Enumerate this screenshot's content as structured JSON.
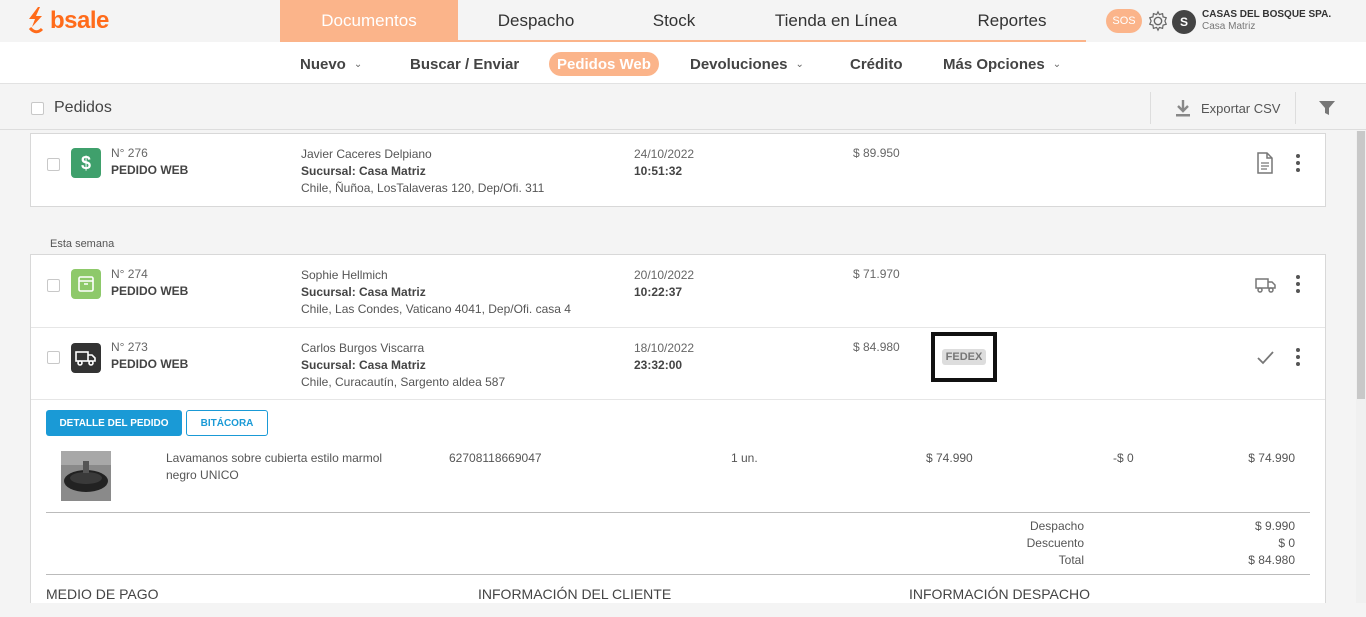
{
  "brand": {
    "name": "bsale",
    "accent": "#ff6b1a",
    "nav_active": "#fbb48a",
    "primary_button": "#1a9ad6"
  },
  "main_nav": [
    {
      "label": "Documentos",
      "active": true
    },
    {
      "label": "Despacho",
      "active": false
    },
    {
      "label": "Stock",
      "active": false
    },
    {
      "label": "Tienda en Línea",
      "active": false
    },
    {
      "label": "Reportes",
      "active": false
    }
  ],
  "header": {
    "sos": "SOS",
    "avatar_initial": "S",
    "company_name": "CASAS DEL BOSQUE SPA.",
    "branch": "Casa Matriz"
  },
  "sub_nav": [
    {
      "label": "Nuevo",
      "dropdown": true,
      "active": false
    },
    {
      "label": "Buscar / Enviar",
      "dropdown": false,
      "active": false
    },
    {
      "label": "Pedidos Web",
      "dropdown": false,
      "active": true
    },
    {
      "label": "Devoluciones",
      "dropdown": true,
      "active": false
    },
    {
      "label": "Crédito",
      "dropdown": false,
      "active": false
    },
    {
      "label": "Más Opciones",
      "dropdown": true,
      "active": false
    }
  ],
  "toolbar": {
    "title": "Pedidos",
    "export_label": "Exportar CSV"
  },
  "orders_top": [
    {
      "number": "N° 276",
      "type": "PEDIDO WEB",
      "client": "Javier Caceres Delpiano",
      "branch": "Sucursal: Casa Matriz",
      "address": "Chile, Ñuñoa, LosTalaveras 120, Dep/Ofi. 311",
      "date": "24/10/2022",
      "time": "10:51:32",
      "amount": "$ 89.950",
      "status_icon": "dollar-icon",
      "action_icon": "document-icon"
    }
  ],
  "section_label": "Esta semana",
  "orders_week": [
    {
      "number": "N° 274",
      "type": "PEDIDO WEB",
      "client": "Sophie Hellmich",
      "branch": "Sucursal: Casa Matriz",
      "address": "Chile, Las Condes, Vaticano 4041, Dep/Ofi. casa 4",
      "date": "20/10/2022",
      "time": "10:22:37",
      "amount": "$ 71.970",
      "status_icon": "package-icon",
      "action_icon": "truck-icon"
    },
    {
      "number": "N° 273",
      "type": "PEDIDO WEB",
      "client": "Carlos Burgos Viscarra",
      "branch": "Sucursal: Casa Matriz",
      "address": "Chile, Curacautín, Sargento aldea 587",
      "date": "18/10/2022",
      "time": "23:32:00",
      "amount": "$ 84.980",
      "carrier": "FEDEX",
      "status_icon": "truck-icon",
      "action_icon": "check-icon"
    }
  ],
  "detail": {
    "btn_detail": "DETALLE DEL PEDIDO",
    "btn_log": "BITÁCORA",
    "product": {
      "name": "Lavamanos sobre cubierta estilo marmol negro UNICO",
      "code": "62708118669047",
      "qty": "1 un.",
      "price": "$ 74.990",
      "discount": "-$ 0",
      "total": "$ 74.990"
    },
    "totals": [
      {
        "label": "Despacho",
        "value": "$ 9.990"
      },
      {
        "label": "Descuento",
        "value": "$ 0"
      },
      {
        "label": "Total",
        "value": "$ 84.980"
      }
    ],
    "info_heads": [
      "MEDIO DE PAGO",
      "INFORMACIÓN DEL CLIENTE",
      "INFORMACIÓN DESPACHO"
    ]
  }
}
